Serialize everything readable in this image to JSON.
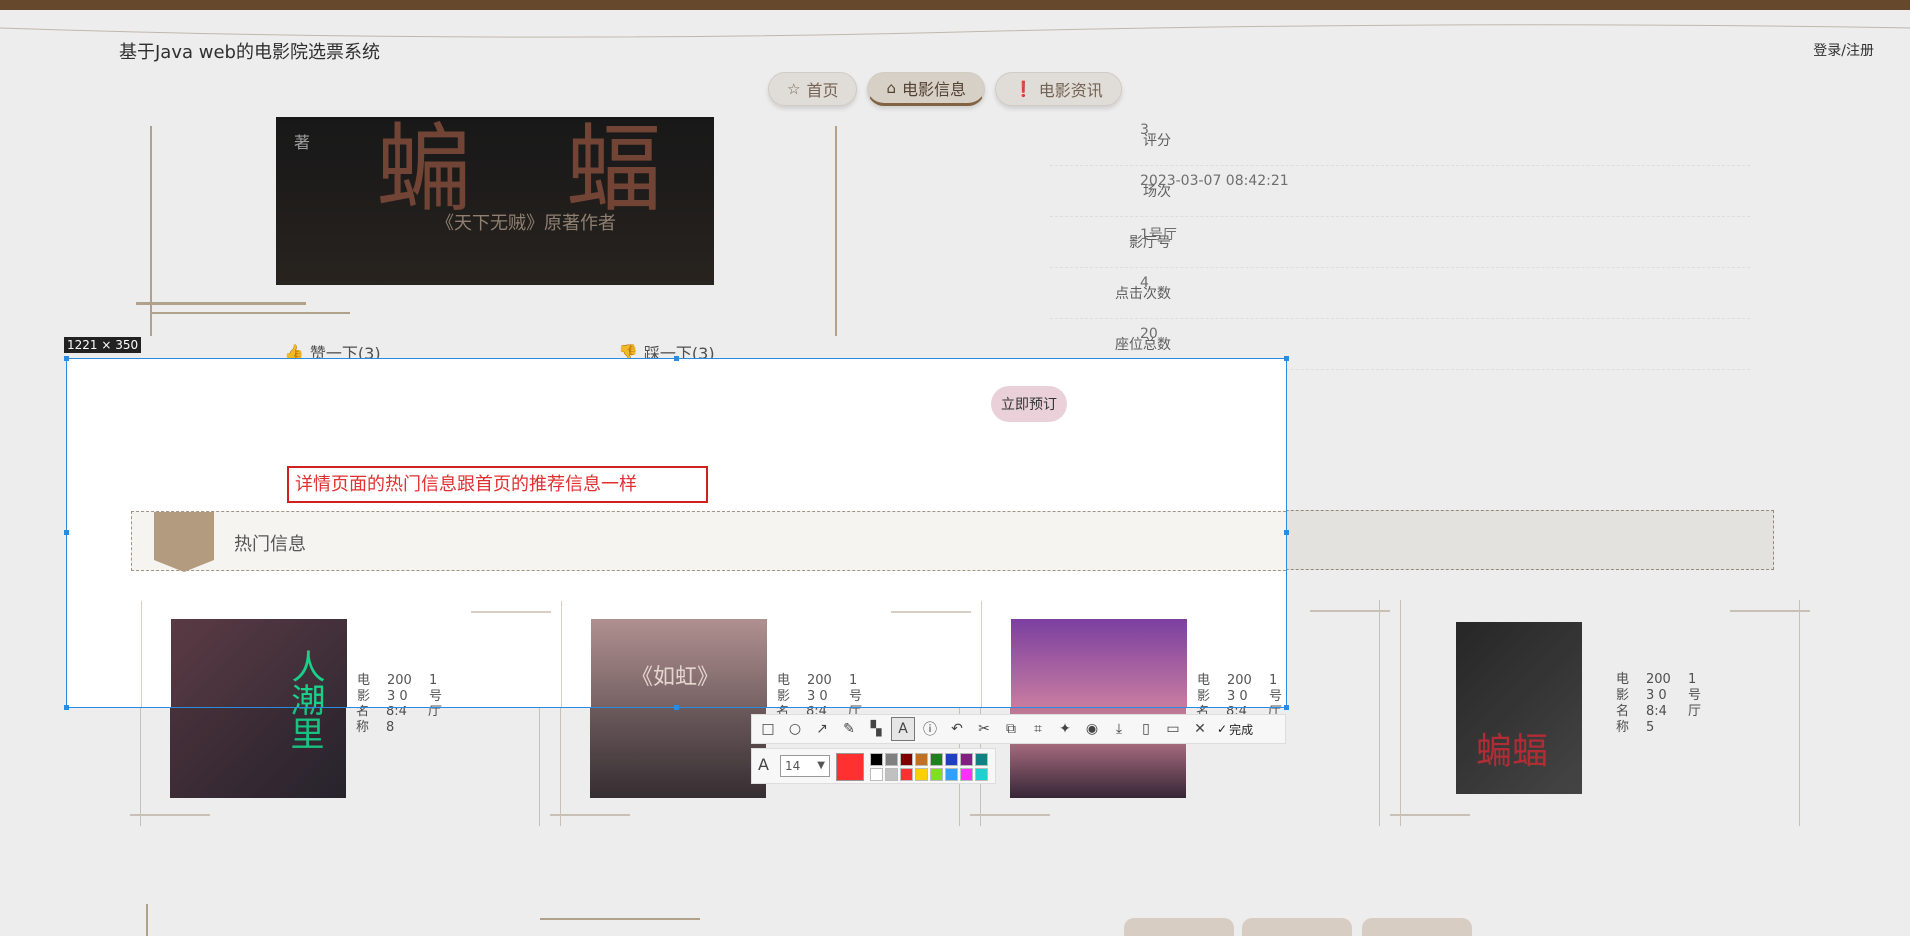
{
  "header": {
    "site_title": "基于Java web的电影院选票系统",
    "login_label": "登录/注册"
  },
  "nav": [
    {
      "label": "首页",
      "icon": "star-icon"
    },
    {
      "label": "电影信息",
      "icon": "bag-icon"
    },
    {
      "label": "电影资讯",
      "icon": "info-icon"
    }
  ],
  "poster": {
    "title_chars": [
      "蝙",
      "蝠"
    ],
    "author": "著",
    "subtitle": "《天下无贼》原著作者"
  },
  "reactions": {
    "like_label": "赞一下(3)",
    "dislike_label": "踩一下(3)"
  },
  "details": [
    {
      "label": "评分",
      "value": "3"
    },
    {
      "label": "场次",
      "value": "2023-03-07 08:42:21"
    },
    {
      "label": "影厅号",
      "value": "1号厅"
    },
    {
      "label": "点击次数",
      "value": "4"
    },
    {
      "label": "座位总数",
      "value": "20"
    }
  ],
  "book_button": "立即预订",
  "annotation_text": "详情页面的热门信息跟首页的推荐信息一样",
  "hot_section": {
    "title": "热门信息"
  },
  "hot_cards": [
    {
      "name_label": "电影名称",
      "time": "2003 08:48",
      "hall": "1号厅",
      "poster": "人潮里",
      "accent": "#1ad18a"
    },
    {
      "name_label": "电影名称",
      "time": "2003 08:4",
      "hall": "1号厅",
      "poster": "《如虹》",
      "accent": "#e6d6d0"
    },
    {
      "name_label": "电影名称",
      "time": "2003 08:46",
      "hall": "1号厅",
      "poster": "",
      "accent": "#7b3fa0"
    },
    {
      "name_label": "电影名称",
      "time": "2003 08:45",
      "hall": "1号厅",
      "poster": "蝙蝠",
      "accent": "#c0303a"
    }
  ],
  "screenshot_tool": {
    "size_label": "1221 × 350",
    "font_size": "14",
    "done_label": "完成",
    "current_color": "#ff3030",
    "palette": [
      "#000000",
      "#808080",
      "#800000",
      "#c07020",
      "#208020",
      "#2040c0",
      "#802080",
      "#108080",
      "#ffffff",
      "#c0c0c0",
      "#ff3030",
      "#ffd000",
      "#80e020",
      "#30a0ff",
      "#ff30ff",
      "#20d0d0"
    ]
  }
}
